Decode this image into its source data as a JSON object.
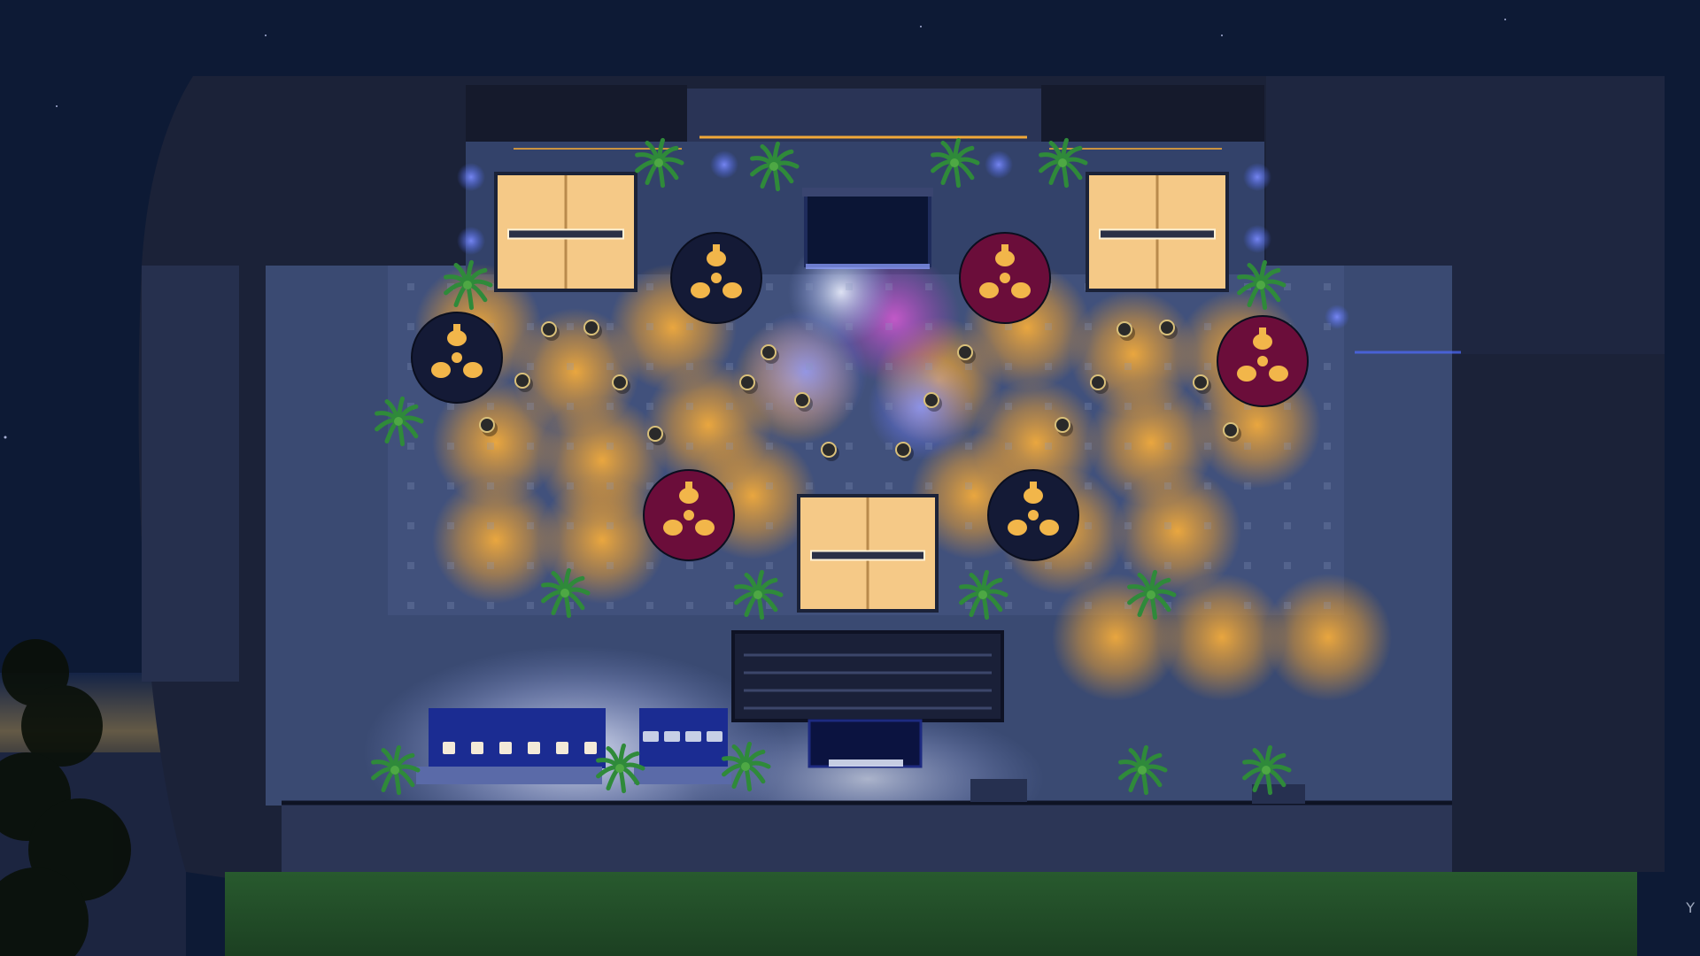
{
  "scene": {
    "subject": "rooftop-venue-night-aerial",
    "sky_color": "#0d1a35",
    "floor_color": "#3a4a72",
    "lawn_color": "#1e4724",
    "warm_light_color": "#f0a838",
    "stage_light_colors": [
      "#c34cbe",
      "#7a86ff",
      "#e8eeff"
    ],
    "tent_fill": "#f5c987",
    "round_table_colors": {
      "navy": "#141a36",
      "maroon": "#6b0d3a"
    },
    "accent_led_color": "#4e6bff",
    "lounge_color": "#1b2c92",
    "round_tables": [
      {
        "color": "navy"
      },
      {
        "color": "maroon"
      },
      {
        "color": "navy"
      },
      {
        "color": "maroon"
      },
      {
        "color": "maroon"
      },
      {
        "color": "navy"
      }
    ],
    "gazebo_count": 3,
    "palm_count": 16,
    "corner_mark": "Y"
  }
}
